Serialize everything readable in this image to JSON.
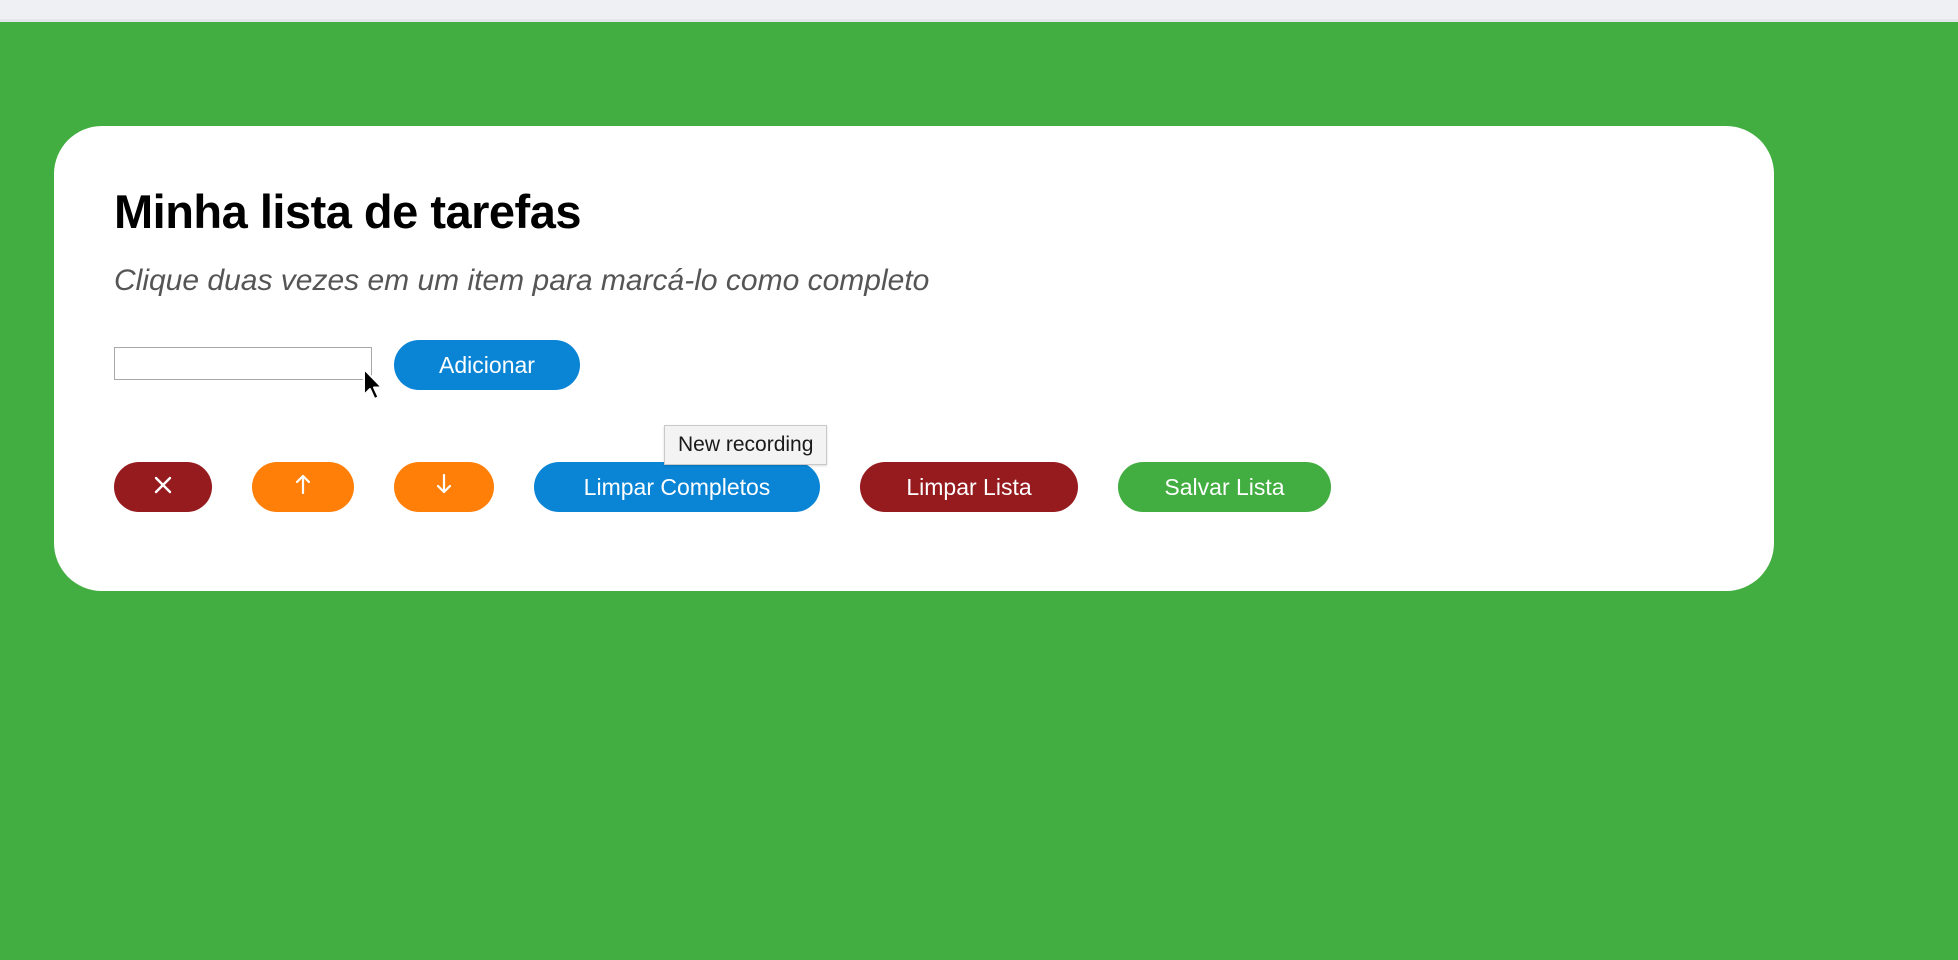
{
  "page": {
    "title": "Minha lista de tarefas",
    "subtitle": "Clique duas vezes em um item para marcá-lo como completo"
  },
  "form": {
    "input_value": "",
    "input_placeholder": "",
    "add_label": "Adicionar"
  },
  "actions": {
    "delete_icon": "x-icon",
    "move_up_icon": "arrow-up-icon",
    "move_down_icon": "arrow-down-icon",
    "clear_completed_label": "Limpar Completos",
    "clear_list_label": "Limpar Lista",
    "save_list_label": "Salvar Lista"
  },
  "tooltip": {
    "text": "New recording"
  },
  "colors": {
    "background": "#42ae41",
    "card": "#ffffff",
    "blue": "#0a85d6",
    "red": "#951b1f",
    "orange": "#ff7f08",
    "green": "#42ae41"
  }
}
